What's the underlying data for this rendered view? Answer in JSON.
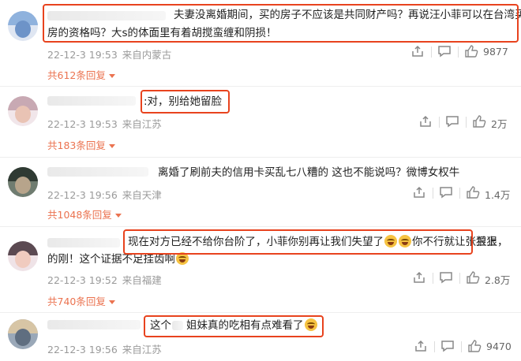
{
  "comments": [
    {
      "text_line1": "夫妻没离婚期间，买的房子不应该是共同财产吗？再说汪小菲可以在台湾买",
      "text_line2": "房的资格吗？大s的体面里有着胡搅蛮缠和阴损！",
      "time": "22-12-3 19:53",
      "location": "来自内蒙古",
      "likes": "9877",
      "replies": "共612条回复"
    },
    {
      "text_line1": ":对，别给她留脸",
      "time": "22-12-3 19:53",
      "location": "来自江苏",
      "likes": "2万",
      "replies": "共183条回复"
    },
    {
      "text_line1": "离婚了刷前夫的信用卡买乱七八糟的 这也不能说吗？微博女权牛",
      "time": "22-12-3 19:56",
      "location": "来自天津",
      "likes": "1.4万",
      "replies": "共1048条回复"
    },
    {
      "text_line1_a": "现在对方已经不给你台阶了，小菲你别再让我们失望了",
      "text_line1_b": "你不行就让张兰上，",
      "text_line1_c": "狠狠",
      "text_line2": "的刚！这个证据不足挂齿啊",
      "time": "22-12-3 19:52",
      "location": "来自福建",
      "likes": "2.8万",
      "replies": "共740条回复"
    },
    {
      "text_line1_a": "这个",
      "text_line1_b": "姐妹真的吃相有点难看了",
      "time": "22-12-3 19:56",
      "location": "来自江苏",
      "likes": "9470"
    }
  ],
  "icons": {
    "share": "share-icon",
    "comment": "comment-icon",
    "like": "thumbs-up-icon",
    "emoji": "laughing-emoji-icon"
  },
  "colors": {
    "highlight_box": "#e8431e",
    "reply_link": "#eb7350",
    "meta_text": "#9a9a9a"
  }
}
